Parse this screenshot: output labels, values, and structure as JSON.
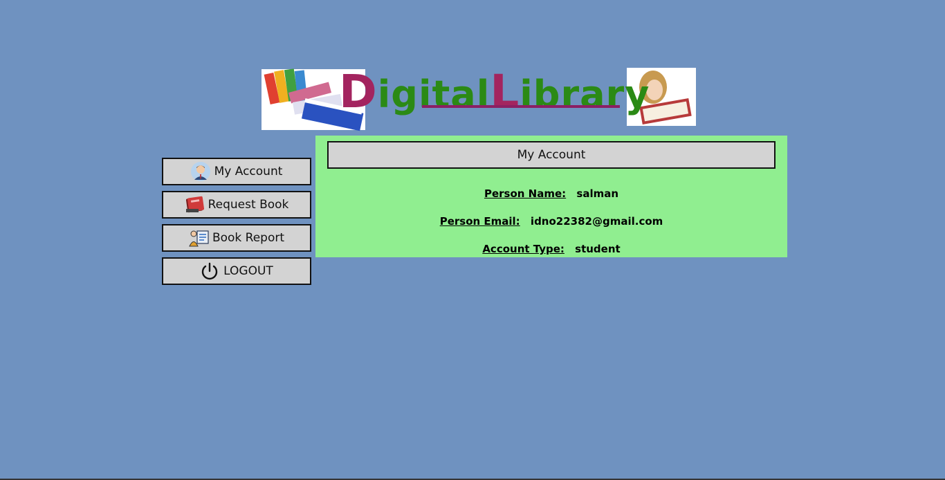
{
  "logo": {
    "text_first_letter": "D",
    "text_first_rest": "igital",
    "text_second_letter": "L",
    "text_second_rest": "ibrary"
  },
  "sidebar": {
    "items": [
      {
        "label": "My Account",
        "icon": "user-icon"
      },
      {
        "label": "Request Book",
        "icon": "book-icon"
      },
      {
        "label": "Book Report",
        "icon": "report-icon"
      },
      {
        "label": "LOGOUT",
        "icon": "power-icon"
      }
    ]
  },
  "main": {
    "title": "My Account",
    "fields": [
      {
        "label": "Person Name:",
        "value": "salman"
      },
      {
        "label": "Person Email:",
        "value": "idno22382@gmail.com"
      },
      {
        "label": "Account Type:",
        "value": "student"
      }
    ]
  },
  "colors": {
    "background": "#6f92c0",
    "panel": "#90ee90",
    "button": "#d3d3d3",
    "logo_magenta": "#a3245f",
    "logo_green": "#2b8a15"
  }
}
